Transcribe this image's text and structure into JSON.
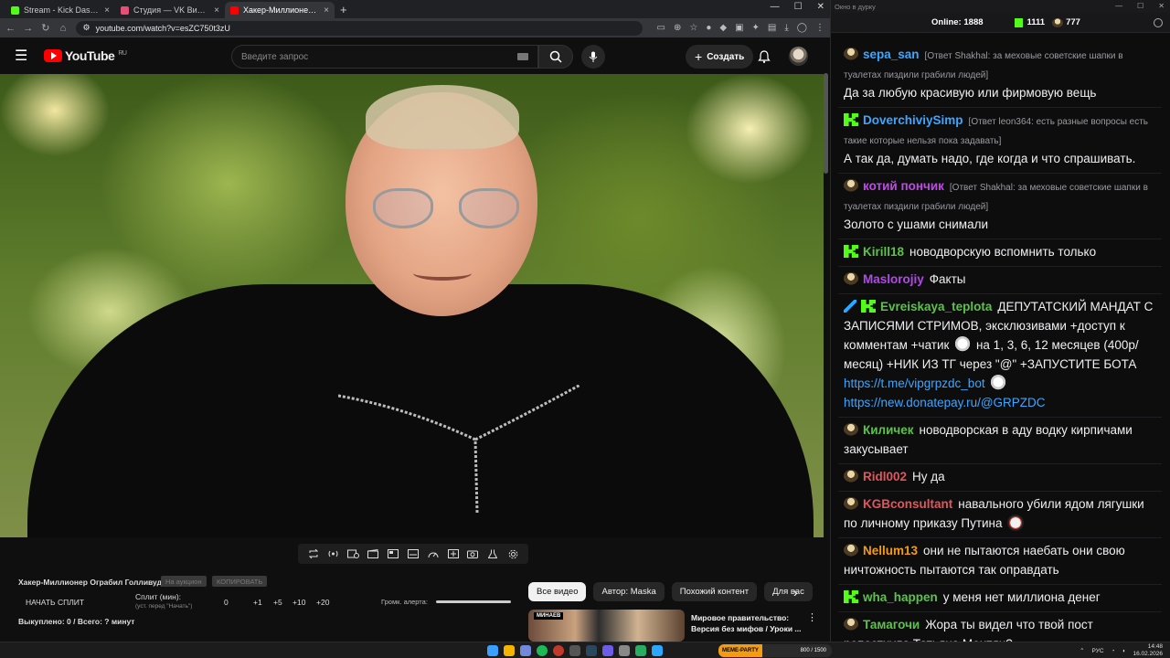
{
  "browser": {
    "tabs": [
      {
        "label": "Stream - Kick Dashboard",
        "color": "#53fc18",
        "active": false
      },
      {
        "label": "Студия — VK Видео Live",
        "color": "#e94e77",
        "active": false
      },
      {
        "label": "Хакер-Миллионер Ограбил Г...",
        "color": "#ff0000",
        "active": true
      }
    ],
    "new_tab": "+",
    "url": "youtube.com/watch?v=esZC750t3zU"
  },
  "youtube": {
    "region": "RU",
    "logo_text": "YouTube",
    "search_placeholder": "Введите запрос",
    "create_label": "Создать",
    "chips": [
      "Все видео",
      "Автор: Maska",
      "Похожий контент",
      "Для вас"
    ],
    "recommended": {
      "thumb_tag": "МИНАЕВ",
      "title": "Мировое правительство: Версия без мифов / Уроки ..."
    }
  },
  "player_icons": [
    "loop-icon",
    "broadcast-icon",
    "camera-list-icon",
    "clapper-icon",
    "pip-icon",
    "subtitles-icon",
    "speed-icon",
    "add-caption-icon",
    "screenshot-icon",
    "lab-icon",
    "settings-icon"
  ],
  "ext": {
    "title": "Хакер-Миллионер Ограбил Голливуд",
    "btn_auction": "На аукцион",
    "btn_copy": "КОПИРОВАТЬ",
    "start_split": "НАЧАТЬ СПЛИТ",
    "split_label": "Сплит (мин):",
    "split_sub": "(уст. перед \"Начать\")",
    "split_values": [
      "0",
      "+1",
      "+5",
      "+10",
      "+20"
    ],
    "volume_label": "Громк. алерта:",
    "bought": "Выкуплено: 0 / Всего: ? минут"
  },
  "chat": {
    "window_title": "Окно в дурку",
    "online_label": "Online:",
    "online_count": "1888",
    "kick_count": "1111",
    "vk_count": "777",
    "messages": [
      {
        "badge": "duck",
        "name": "sepa_san",
        "color": "#3ea6ff",
        "reply": "[Ответ Shakhal: за меховые советские шапки в туалетах пиздили грабили людей]",
        "text": "Да за любую красивую или фирмовую вещь"
      },
      {
        "badge": "kick",
        "name": "DoverchiviySimp",
        "color": "#3ea6ff",
        "reply": "[Ответ leon364: есть разные вопросы есть такие которые нельзя пока задавать]",
        "text": "А так да, думать надо, где когда и что спрашивать."
      },
      {
        "badge": "duck",
        "name": "котий пончик",
        "color": "#c04ae6",
        "reply": "[Ответ Shakhal: за меховые советские шапки в туалетах пиздили грабили людей]",
        "text": "Золото с ушами снимали"
      },
      {
        "badge": "kick",
        "name": "Kirill18",
        "color": "#5cc24a",
        "reply": "",
        "text": "новодворскую вспомнить только"
      },
      {
        "badge": "duck",
        "name": "Maslorojiy",
        "color": "#b04ae6",
        "reply": "",
        "text": "Факты"
      },
      {
        "badge": "kick",
        "name": "Evreiskaya_teplota",
        "color": "#5cc24a",
        "reply": "",
        "text": "ДЕПУТАТСКИЙ МАНДАТ С ЗАПИСЯМИ СТРИМОВ, эксклюзивами +доступ к комментам +чатик",
        "text2": "на 1, 3, 6, 12 месяцев (400р/месяц) +НИК ИЗ ТГ через \"@\" +ЗАПУСТИТЕ БОТА",
        "link1": "https://t.me/vipgrpzdc_bot",
        "link2": "https://new.donatepay.ru/@GRPZDC"
      },
      {
        "badge": "duck",
        "name": "Киличек",
        "color": "#5cc24a",
        "reply": "",
        "text": "новодворская в аду водку кирпичами закусывает"
      },
      {
        "badge": "duck",
        "name": "Ridl002",
        "color": "#e0565b",
        "reply": "",
        "text": "Ну да"
      },
      {
        "badge": "duck",
        "name": "KGBconsultant",
        "color": "#e0565b",
        "reply": "",
        "text": "навального убили ядом лягушки по личному приказу Путина"
      },
      {
        "badge": "duck",
        "name": "Nellum13",
        "color": "#f39c12",
        "reply": "",
        "text": "они не пытаются наебать они свою ничтожность пытаются так оправдать"
      },
      {
        "badge": "kick",
        "name": "wha_happen",
        "color": "#5cc24a",
        "reply": "",
        "text": "у меня нет миллиона денег"
      },
      {
        "badge": "duck",
        "name": "Тамагочи",
        "color": "#5cc24a",
        "reply": "",
        "text": "Жора ты видел что твой пост репостнула Татьяна Монтян?"
      }
    ]
  },
  "taskbar": {
    "widget_title": "MEME-PARTY",
    "widget_count": "800 / 1500",
    "lang": "РУС",
    "time": "14:48",
    "date": "16.02.2026"
  }
}
